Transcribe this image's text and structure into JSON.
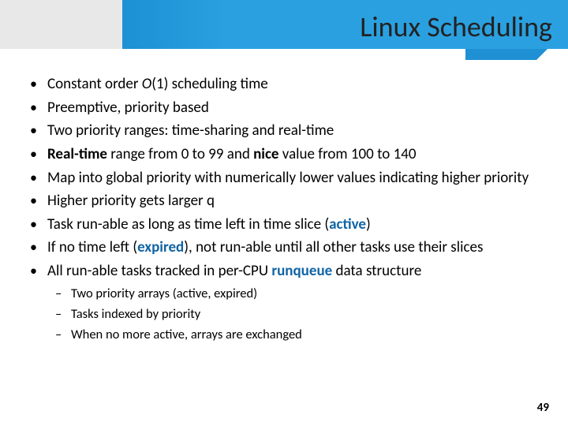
{
  "title": "Linux Scheduling",
  "bullets": {
    "b1a": "Constant order ",
    "b1b": "O",
    "b1c": "(1) scheduling time",
    "b2": "Preemptive, priority based",
    "b3": "Two priority ranges: time-sharing and real-time",
    "b4a": "Real-time",
    "b4b": " range from 0 to 99 and ",
    "b4c": "nice",
    "b4d": " value from 100 to 140",
    "b5": "Map into  global priority with numerically lower values indicating higher priority",
    "b6": "Higher priority gets larger q",
    "b7a": "Task run-able as long as time left in time slice (",
    "b7b": "active",
    "b7c": ")",
    "b8a": "If no time left (",
    "b8b": "expired",
    "b8c": "), not run-able until all other tasks use their slices",
    "b9a": "All run-able tasks tracked in per-CPU ",
    "b9b": "runqueue",
    "b9c": " data structure"
  },
  "sub": {
    "s1": "Two priority arrays (active, expired)",
    "s2": "Tasks indexed by priority",
    "s3": "When no more active, arrays are exchanged"
  },
  "page": "49"
}
